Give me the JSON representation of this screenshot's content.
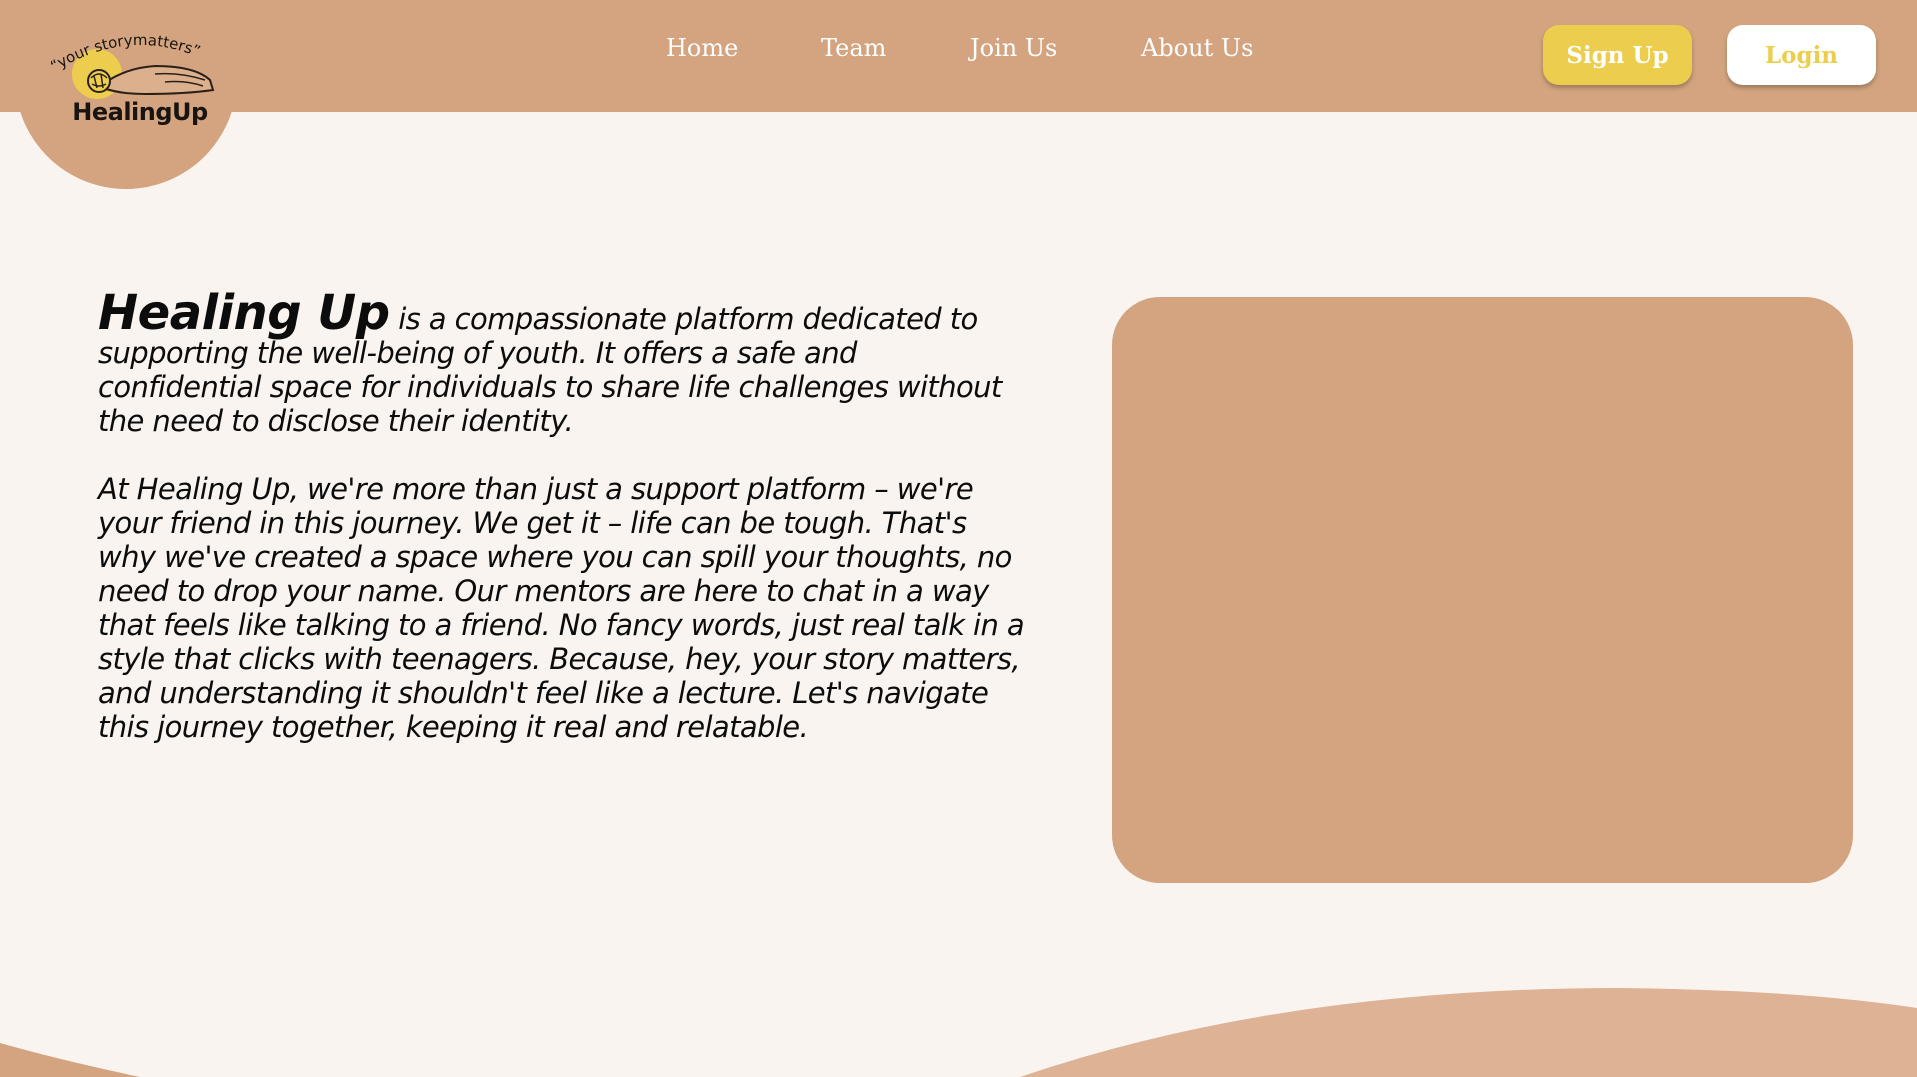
{
  "logo": {
    "tagline": "“your storymatters”",
    "name": "HealingUp"
  },
  "nav": {
    "home": "Home",
    "team": "Team",
    "join": "Join Us",
    "about": "About Us"
  },
  "actions": {
    "signup": "Sign Up",
    "login": "Login"
  },
  "intro": {
    "brand": "Healing Up",
    "para1_rest": " is a compassionate platform dedicated to supporting the well-being of youth. It offers a safe and confidential space for individuals to share life challenges without the need to disclose their identity.",
    "para2": "At Healing Up, we're more than just a support platform – we're your friend in this journey. We get it – life can be tough. That's why we've created a space where you can spill your thoughts, no need to drop your name. Our mentors are here to chat in a way that feels like talking to a friend. No fancy words, just real talk in a style that clicks with teenagers. Because, hey, your story matters, and understanding it shouldn't feel like a lecture. Let's navigate this journey together, keeping it real and relatable."
  },
  "colors": {
    "primary": "#d3a47f",
    "background": "#f9f4ef",
    "accent": "#eccd4d",
    "wave": "#deb395"
  },
  "icons": {
    "logo_art": "person-lying-with-sun-icon"
  }
}
